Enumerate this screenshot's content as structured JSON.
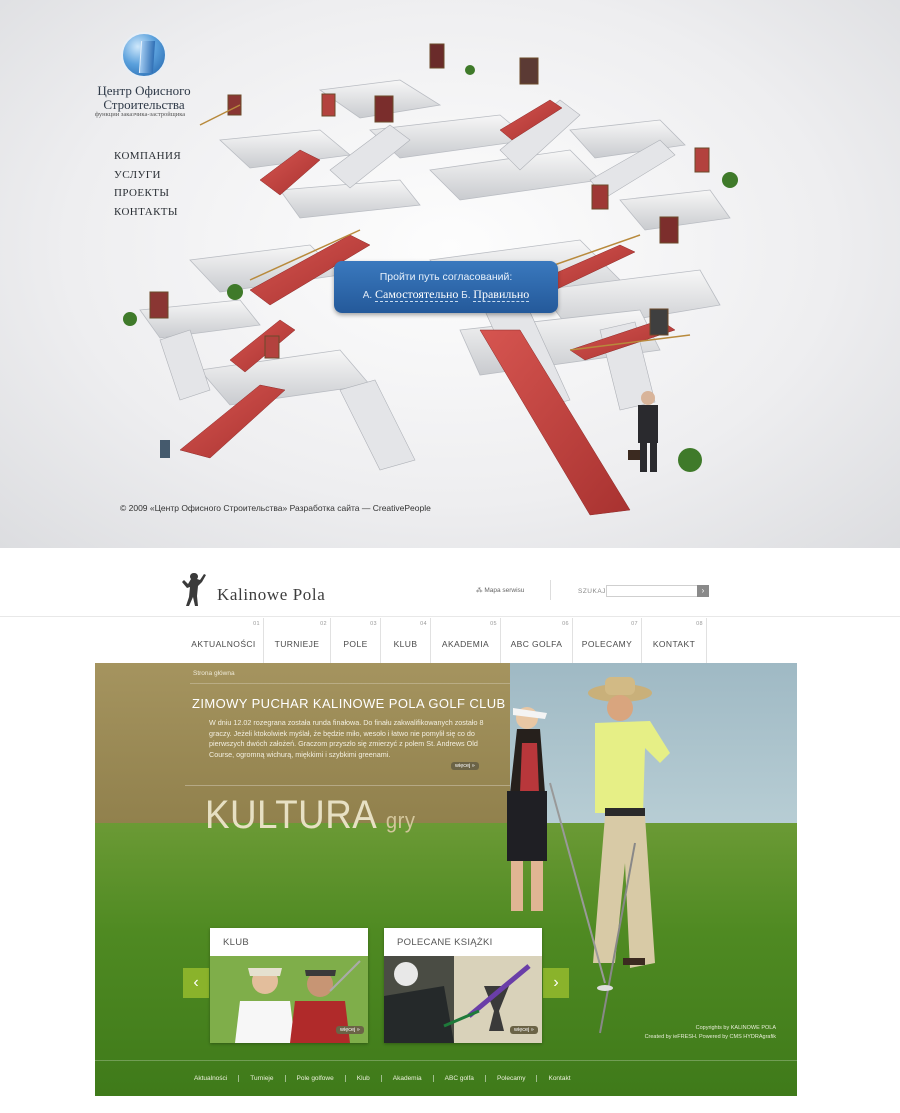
{
  "top_site": {
    "logo_title_1": "Центр Офисного",
    "logo_title_2": "Строительства",
    "logo_subtitle": "функции заказчика-застройщика",
    "nav": [
      "КОМПАНИЯ",
      "УСЛУГИ",
      "ПРОЕКТЫ",
      "КОНТАКТЫ"
    ],
    "cta": {
      "title": "Пройти путь согласований:",
      "option_a_prefix": "А.",
      "option_a": "Самостоятельно",
      "option_b_prefix": "Б.",
      "option_b": "Правильно"
    },
    "footer": "© 2009 «Центр Офисного Строительства» Разработка сайта — CreativePeople",
    "colors": {
      "cta_blue": "#2d66aa",
      "carpet_red": "#c9443f"
    }
  },
  "bottom_site": {
    "logo": "Kalinowe Pola",
    "sitemap": "Mapa serwisu",
    "search_label": "SZUKAJ",
    "search_button": "›",
    "nav": [
      {
        "num": "01",
        "label": "AKTUALNOŚCI"
      },
      {
        "num": "02",
        "label": "TURNIEJE"
      },
      {
        "num": "03",
        "label": "POLE"
      },
      {
        "num": "04",
        "label": "KLUB"
      },
      {
        "num": "05",
        "label": "AKADEMIA"
      },
      {
        "num": "06",
        "label": "ABC GOLFA"
      },
      {
        "num": "07",
        "label": "POLECAMY"
      },
      {
        "num": "08",
        "label": "KONTAKT"
      }
    ],
    "breadcrumb": "Strona główna",
    "news_title": "ZIMOWY PUCHAR KALINOWE POLA GOLF CLUB",
    "news_text": "W dniu 12.02 rozegrana została runda finałowa. Do finału zakwalifikowanych zostało 8 graczy. Jeżeli ktokolwiek myślał, że będzie miło, wesoło i łatwo nie pomylił się co do pierwszych dwóch założeń. Graczom przyszło się zmierzyć z polem St. Andrews Old Course, ogromną wichurą, miękkimi i szybkimi greenami.",
    "more_label": "więcej »",
    "slogan_main": "KULTURA",
    "slogan_small": "gry",
    "cards": [
      {
        "title": "KLUB",
        "more": "więcej »"
      },
      {
        "title": "POLECANE KSIĄŻKI",
        "more": "więcej »"
      }
    ],
    "prev_arrow": "‹",
    "next_arrow": "›",
    "credits_1": "Copyrights by KALINOWE POLA",
    "credits_2": "Created by ieFRESH. Powered by CMS HYDRAgrafik",
    "footer_links": [
      "Aktualności",
      "Turnieje",
      "Pole golfowe",
      "Klub",
      "Akademia",
      "ABC golfa",
      "Polecamy",
      "Kontakt"
    ],
    "colors": {
      "green_accent": "#8ab32b",
      "olive": "#918553"
    }
  }
}
